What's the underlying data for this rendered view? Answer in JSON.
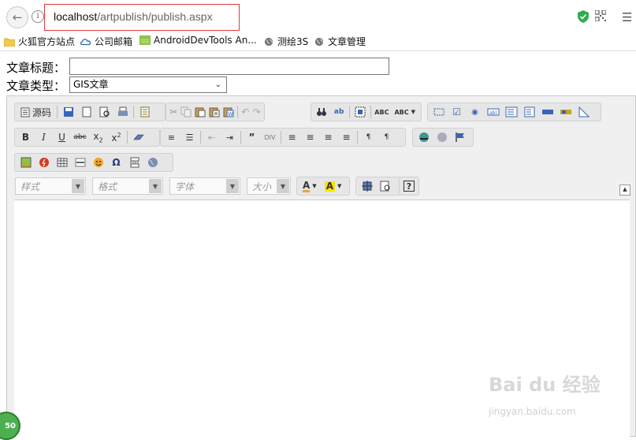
{
  "browser": {
    "url_host": "localhost",
    "url_path": "/artpublish/publish.aspx",
    "menu_glyph": "☰"
  },
  "bookmarks": [
    {
      "label": "火狐官方站点",
      "icon": "folder-icon"
    },
    {
      "label": "公司邮箱",
      "icon": "cloud-icon"
    },
    {
      "label": "AndroidDevTools An...",
      "icon": "android-icon"
    },
    {
      "label": "测绘3S",
      "icon": "globe-icon"
    },
    {
      "label": "文章管理",
      "icon": "globe-icon"
    }
  ],
  "form": {
    "title_label": "文章标题：",
    "title_value": "",
    "type_label": "文章类型：",
    "type_value": "GIS文章"
  },
  "toolbar": {
    "source_label": "源码",
    "combos": {
      "style": "样式",
      "format": "格式",
      "font": "字体",
      "size": "大小"
    }
  },
  "watermark": {
    "text": "Bai du 经验",
    "sub": "jingyan.baidu.com"
  },
  "badge": "50",
  "colors": {
    "url_highlight": "#e03a3a",
    "toolbar_bg": "#e6e6e6",
    "badge_green": "#4caf50"
  }
}
